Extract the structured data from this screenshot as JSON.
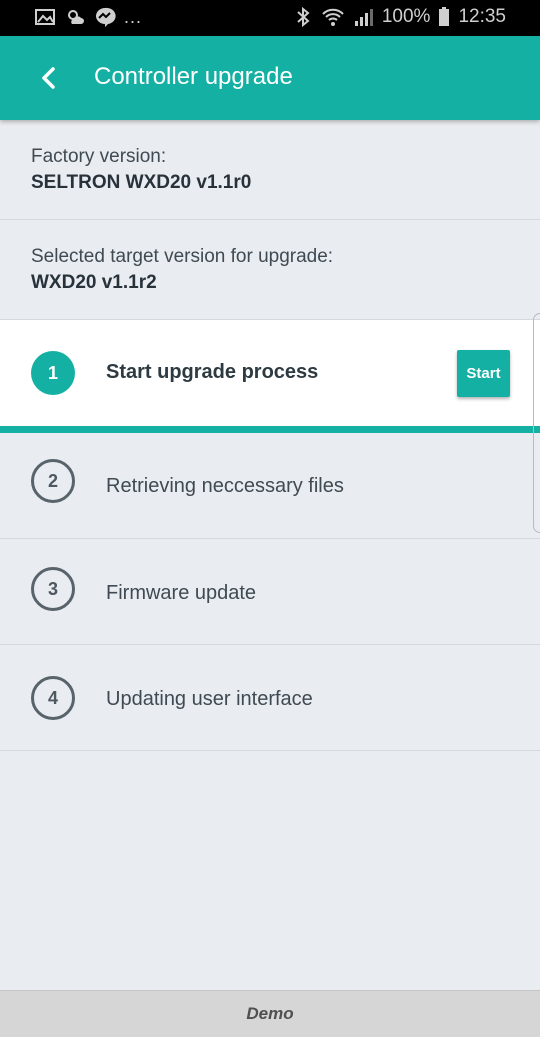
{
  "status_bar": {
    "left_icons": [
      "gallery-icon",
      "weather-icon",
      "messenger-icon"
    ],
    "overflow": "...",
    "right_icons": [
      "bluetooth-icon",
      "wifi-icon",
      "signal-icon"
    ],
    "battery": "100%",
    "time": "12:35"
  },
  "app_bar": {
    "title": "Controller upgrade",
    "back_icon": "chevron-left-icon"
  },
  "factory": {
    "label": "Factory version:",
    "value": "SELTRON WXD20 v1.1r0"
  },
  "target": {
    "label": "Selected target version for upgrade:",
    "value": "WXD20 v1.1r2"
  },
  "steps": [
    {
      "number": "1",
      "label": "Start upgrade process",
      "active": true,
      "button": "Start"
    },
    {
      "number": "2",
      "label": "Retrieving neccessary files",
      "active": false
    },
    {
      "number": "3",
      "label": "Firmware update",
      "active": false
    },
    {
      "number": "4",
      "label": "Updating user interface",
      "active": false
    }
  ],
  "footer": {
    "label": "Demo"
  },
  "colors": {
    "accent": "#14b0a3",
    "background": "#e9ecf0",
    "text": "#3f4a52"
  }
}
